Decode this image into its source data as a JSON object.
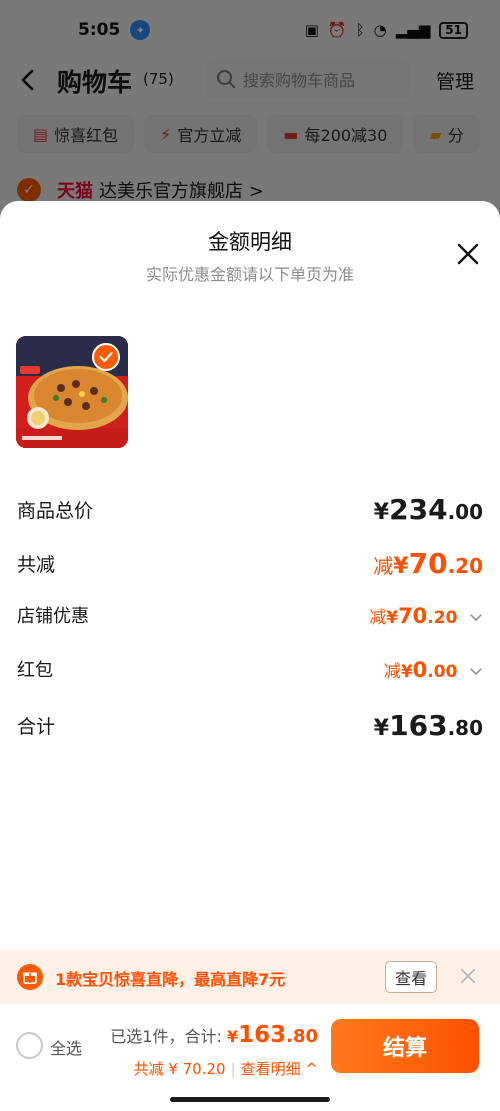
{
  "status_bar": {
    "time": "5:05",
    "battery": "51"
  },
  "cart_header": {
    "title": "购物车",
    "count": "(75)",
    "search_placeholder": "搜索购物车商品",
    "manage_label": "管理"
  },
  "promo_chips": [
    {
      "label": "惊喜红包",
      "icon": "red-envelope-icon"
    },
    {
      "label": "官方立减",
      "icon": "lightning-icon"
    },
    {
      "label": "每200减30",
      "icon": "coupon-icon"
    },
    {
      "label": "分",
      "icon": "folder-icon"
    }
  ],
  "store": {
    "brand": "天猫",
    "name": "达美乐官方旗舰店 >"
  },
  "sheet": {
    "title": "金额明细",
    "subtitle": "实际优惠金额请以下单页为准",
    "rows": {
      "total_goods": {
        "label": "商品总价",
        "currency": "¥",
        "int": "234",
        "dec": ".00"
      },
      "total_reduce": {
        "label": "共减",
        "prefix": "减",
        "currency": "¥",
        "int": "70",
        "dec": ".20"
      },
      "store_discount": {
        "label": "店铺优惠",
        "prefix": "减",
        "currency": "¥",
        "int": "70",
        "dec": ".20"
      },
      "red_packet": {
        "label": "红包",
        "prefix": "减",
        "currency": "¥",
        "int": "0",
        "dec": ".00"
      },
      "subtotal": {
        "label": "合计",
        "currency": "¥",
        "int": "163",
        "dec": ".80"
      }
    }
  },
  "notice": {
    "text": "1款宝贝惊喜直降，最高直降7元",
    "view_label": "查看"
  },
  "footer": {
    "select_all_label": "全选",
    "selected_text": "已选1件，合计:",
    "total_currency": "¥",
    "total_int": "163",
    "total_dec": ".80",
    "reduce_text": "共减 ¥ 70.20",
    "detail_link": "查看明细 ^",
    "checkout_label": "结算"
  },
  "colors": {
    "accent": "#ff5000",
    "brand_tmall": "#ff0036"
  }
}
